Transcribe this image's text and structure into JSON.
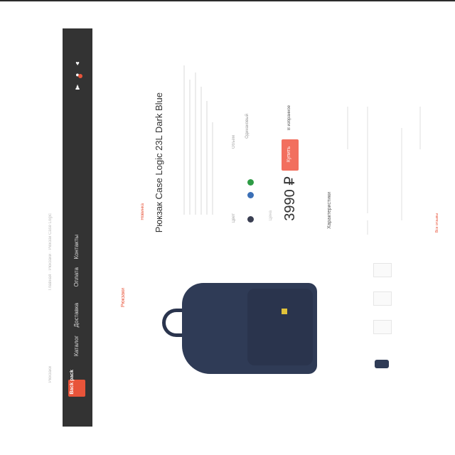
{
  "brand": {
    "name": "Back pack",
    "accent": "#e8543a"
  },
  "nav": {
    "items": [
      "Каталог",
      "Доставка",
      "Оплата",
      "Контакты"
    ]
  },
  "header_icons": [
    "heart-icon",
    "cart-icon",
    "user-icon"
  ],
  "breadcrumb": {
    "text": "Главная · Рюкзаки · Рюкзак Case Logic",
    "left_text": "Рюкзаки"
  },
  "product": {
    "category_link": "Рюкзаки",
    "tag": "Новинка",
    "title": "Рюкзак Case Logic 23L Dark Blue",
    "color_label": "Цвет",
    "size_label": "Объём",
    "size_options": [
      "Одинаковый"
    ],
    "colors": [
      "#3a3f52",
      "#3b6fb6",
      "#2e9b45"
    ],
    "price_label": "Цена",
    "price": "3990 ₽",
    "buy_label": "Купить",
    "favorite_label": "В избранное",
    "specs_title": "Характеристики"
  },
  "footer": {
    "link": "Все отзывы"
  }
}
